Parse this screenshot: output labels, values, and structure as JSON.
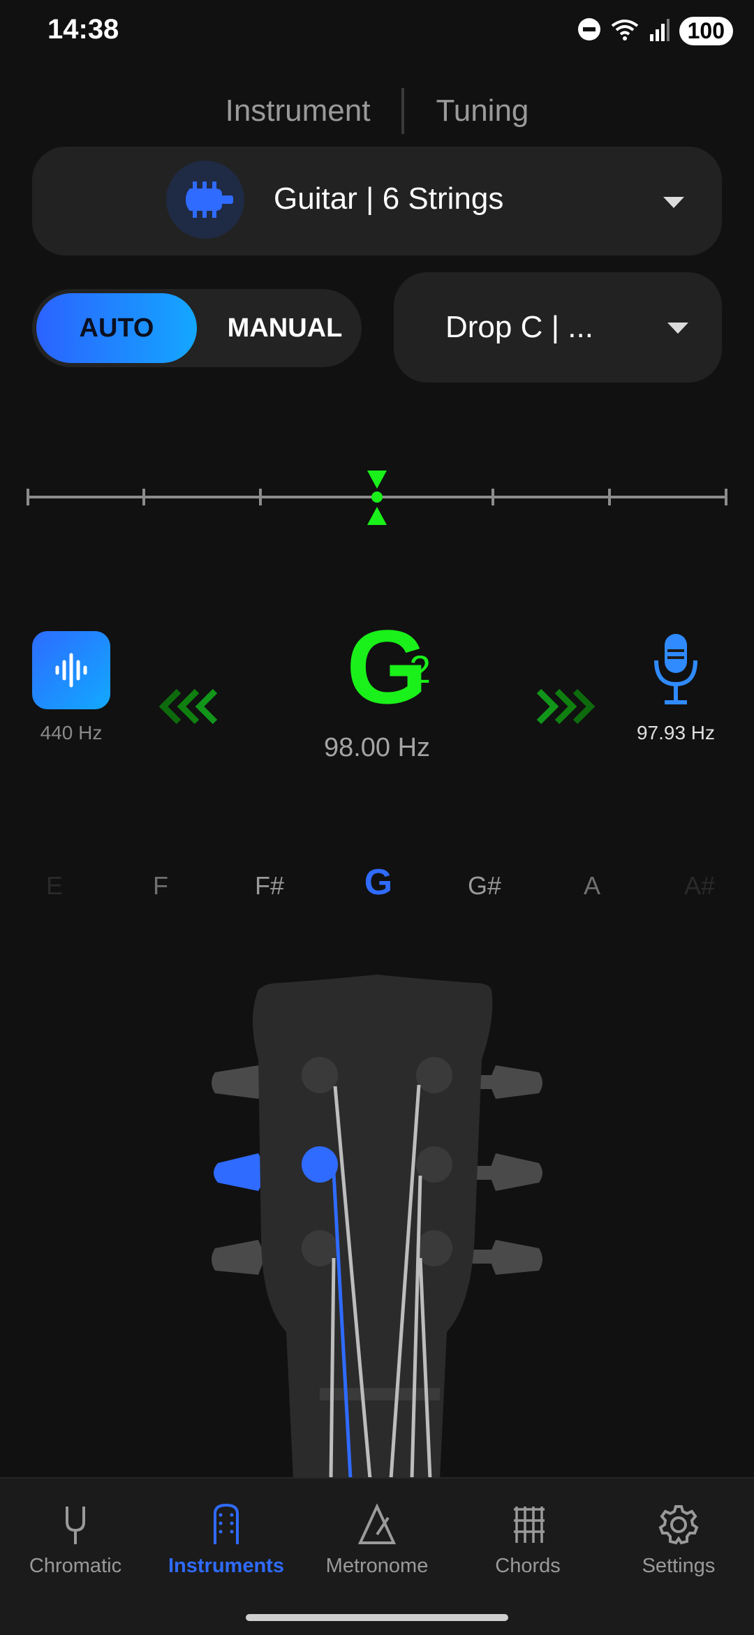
{
  "status": {
    "time": "14:38",
    "battery": "100"
  },
  "mode_tabs": {
    "instrument": "Instrument",
    "tuning": "Tuning"
  },
  "instrument_select": {
    "label": "Guitar | 6 Strings"
  },
  "mode_toggle": {
    "auto": "AUTO",
    "manual": "MANUAL",
    "selected": "AUTO"
  },
  "tuning_select": {
    "label": "Drop C | ..."
  },
  "tuner": {
    "reference_hz": "440 Hz",
    "note": "G",
    "octave": "2",
    "target_hz": "98.00 Hz",
    "detected_hz": "97.93 Hz"
  },
  "note_strip": [
    "E",
    "F",
    "F#",
    "G",
    "G#",
    "A",
    "A#"
  ],
  "note_strip_active": "G",
  "nav": {
    "chromatic": "Chromatic",
    "instruments": "Instruments",
    "metronome": "Metronome",
    "chords": "Chords",
    "settings": "Settings",
    "active": "Instruments"
  },
  "colors": {
    "accent": "#2f6bff",
    "in_tune": "#1af01a",
    "background": "#111111"
  },
  "icons": [
    "guitar-headstock-icon",
    "sound-wave-icon",
    "microphone-icon",
    "tuning-fork-icon",
    "metronome-icon",
    "chord-grid-icon",
    "gear-icon"
  ]
}
